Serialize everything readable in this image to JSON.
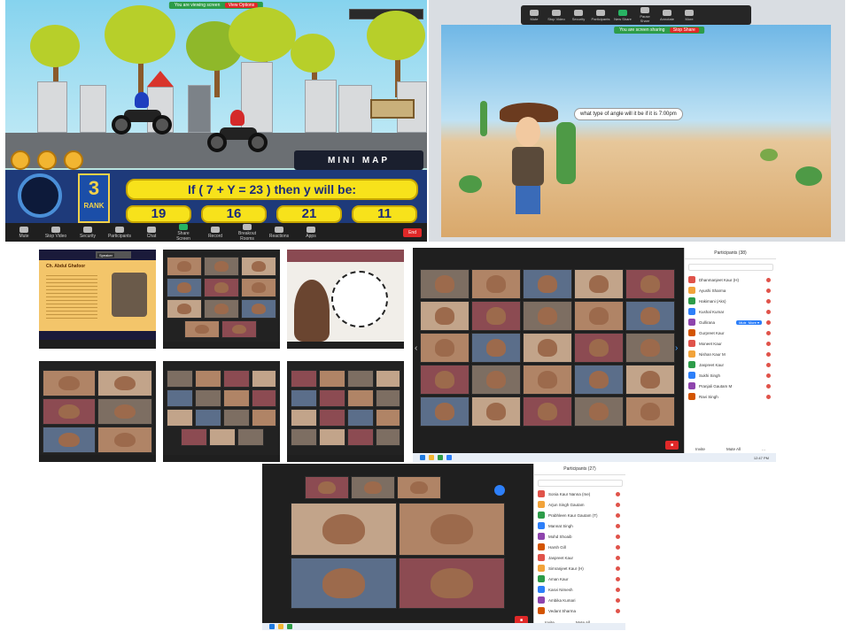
{
  "game": {
    "share_banner": "You are viewing screen",
    "stop_label": "View Options",
    "mini_map": "MINI MAP",
    "rank_number": "3",
    "rank_label": "RANK",
    "question": "If ( 7 + Y = 23 ) then y will be:",
    "answers": [
      "19",
      "16",
      "21",
      "11"
    ],
    "toolbar": [
      "Mute",
      "Stop Video",
      "Security",
      "Participants",
      "Chat",
      "Share Screen",
      "Record",
      "Breakout Rooms",
      "Reactions",
      "Apps"
    ],
    "end_label": "End"
  },
  "desert": {
    "speech": "what type of angle will it be if it is 7:00pm",
    "toolbar": [
      "Mute",
      "Stop Video",
      "Security",
      "Participants",
      "New Share",
      "Pause Share",
      "Annotate",
      "More"
    ],
    "share_banner": "You are screen sharing",
    "stop_label": "Stop Share"
  },
  "presentation": {
    "slide_title": "Ch. Abdul Ghafoor",
    "speaker_name": "Speaker"
  },
  "gallery_main": {
    "participants_title": "Participants (38)",
    "participants": [
      "Dhanmanjeet Kaur (H)",
      "Ayushi Sharma",
      "Hakimani (Aks)",
      "Kushal Kumar",
      "Gullirana",
      "Gurpreet Kaur",
      "Moneet Kaur",
      "Nishan Kaur M",
      "Jaspreet Kaur",
      "Sukhi Singh",
      "Pranjali Gautam M",
      "Ravi Singh"
    ],
    "mute_label": "Mute",
    "more_label": "More ▾",
    "footer": [
      "Invite",
      "Mute All",
      "..."
    ],
    "clock": "12:47 PM"
  },
  "gallery_bottom": {
    "participants_title": "Participants (27)",
    "participants": [
      "Sonia Kaur Nanna (me)",
      "Arjun Singh Gautam",
      "Prabhleen Kaur Gautam (T)",
      "Mannat Singh",
      "Mohd Shoaib",
      "Harsh Gill",
      "Jaspreet Kaur",
      "Simranjeet Kaur (H)",
      "Aman Kaur",
      "Kasvi Nimesh",
      "Ambika Kumari",
      "Vedant Sharma"
    ],
    "footer": [
      "Invite",
      "Mute All",
      "..."
    ]
  },
  "colors": {
    "zoom_bar": "#1f1f1f",
    "end_red": "#e02828",
    "share_green": "#2d9c49",
    "question_yellow": "#f7e21b",
    "rank_blue": "#1b4ea8"
  }
}
